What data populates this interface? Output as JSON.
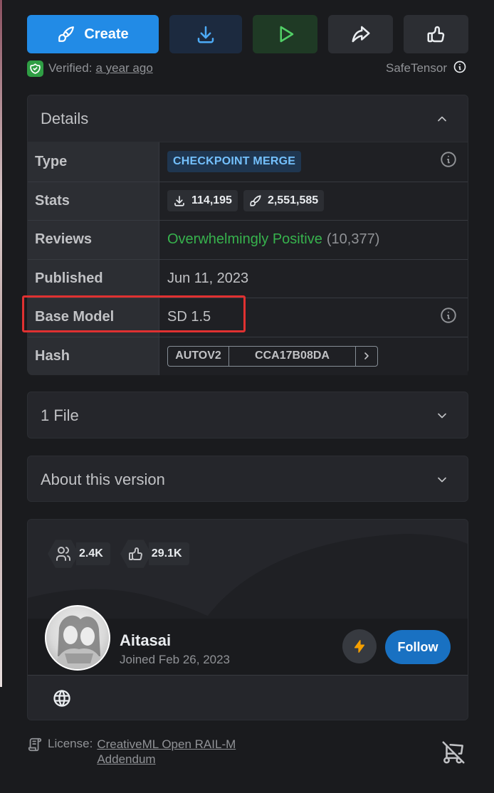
{
  "actions": {
    "create_label": "Create"
  },
  "verification": {
    "verified_label": "Verified:",
    "verified_time": "a year ago",
    "format_label": "SafeTensor"
  },
  "details": {
    "title": "Details",
    "rows": {
      "type": {
        "label": "Type",
        "value": "CHECKPOINT MERGE"
      },
      "stats": {
        "label": "Stats",
        "downloads": "114,195",
        "generations": "2,551,585"
      },
      "reviews": {
        "label": "Reviews",
        "sentiment": "Overwhelmingly Positive",
        "count": "(10,377)"
      },
      "published": {
        "label": "Published",
        "value": "Jun 11, 2023"
      },
      "base_model": {
        "label": "Base Model",
        "value": "SD 1.5"
      },
      "hash": {
        "label": "Hash",
        "algorithm": "AUTOV2",
        "value": "CCA17B08DA"
      }
    }
  },
  "files_section": {
    "title": "1 File"
  },
  "about_section": {
    "title": "About this version"
  },
  "creator": {
    "followers": "2.4K",
    "likes": "29.1K",
    "username": "Aitasai",
    "joined": "Joined Feb 26, 2023",
    "follow_label": "Follow"
  },
  "license": {
    "label": "License:",
    "line1": "CreativeML Open RAIL-M",
    "line2": "Addendum"
  },
  "colors": {
    "accent": "#228be6",
    "positive": "#37b24d",
    "highlight": "#e03131",
    "follow": "#1971c2"
  },
  "icons": [
    "brush-icon",
    "download-icon",
    "play-icon",
    "share-icon",
    "thumbs-up-icon",
    "shield-check-icon",
    "info-icon",
    "chevron-up-icon",
    "chevron-down-icon",
    "chevron-right-icon",
    "users-icon",
    "bolt-icon",
    "globe-icon",
    "license-icon",
    "cart-off-icon"
  ]
}
